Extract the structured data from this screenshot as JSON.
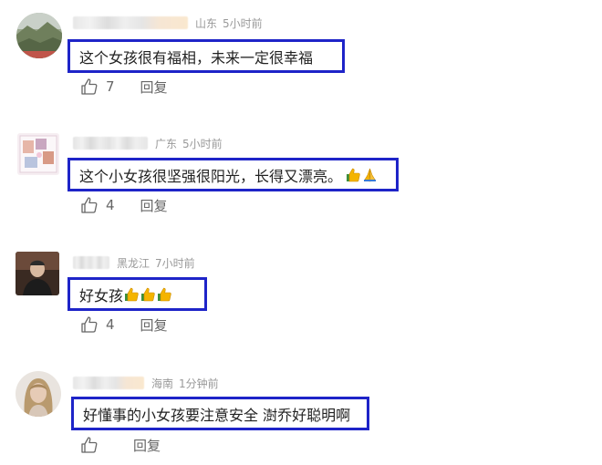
{
  "comments": [
    {
      "location": "山东",
      "time": "5小时前",
      "text": "这个女孩很有福相，未来一定很幸福",
      "emoji_thumbs": 0,
      "likes": "7",
      "reply_label": "回复",
      "avatar": "landscape-photo-avatar"
    },
    {
      "location": "广东",
      "time": "5小时前",
      "text": "这个小女孩很坚强很阳光，长得又漂亮。",
      "emoji_thumbs": 2,
      "likes": "4",
      "reply_label": "回复",
      "avatar": "photo-collage-avatar"
    },
    {
      "location": "黑龙江",
      "time": "7小时前",
      "text": "好女孩",
      "emoji_thumbs": 3,
      "likes": "4",
      "reply_label": "回复",
      "avatar": "man-portrait-avatar"
    },
    {
      "location": "海南",
      "time": "1分钟前",
      "text": "好懂事的小女孩要注意安全 澍乔好聪明啊",
      "emoji_thumbs": 0,
      "likes": "",
      "reply_label": "回复",
      "avatar": "woman-portrait-avatar"
    }
  ],
  "icons": {
    "like": "thumbs-up-outline-icon",
    "emoji": "thumbs-up-emoji"
  },
  "colors": {
    "highlight_border": "#1e24c8",
    "meta_text": "#999999",
    "action_text": "#666666",
    "comment_text": "#222222"
  }
}
